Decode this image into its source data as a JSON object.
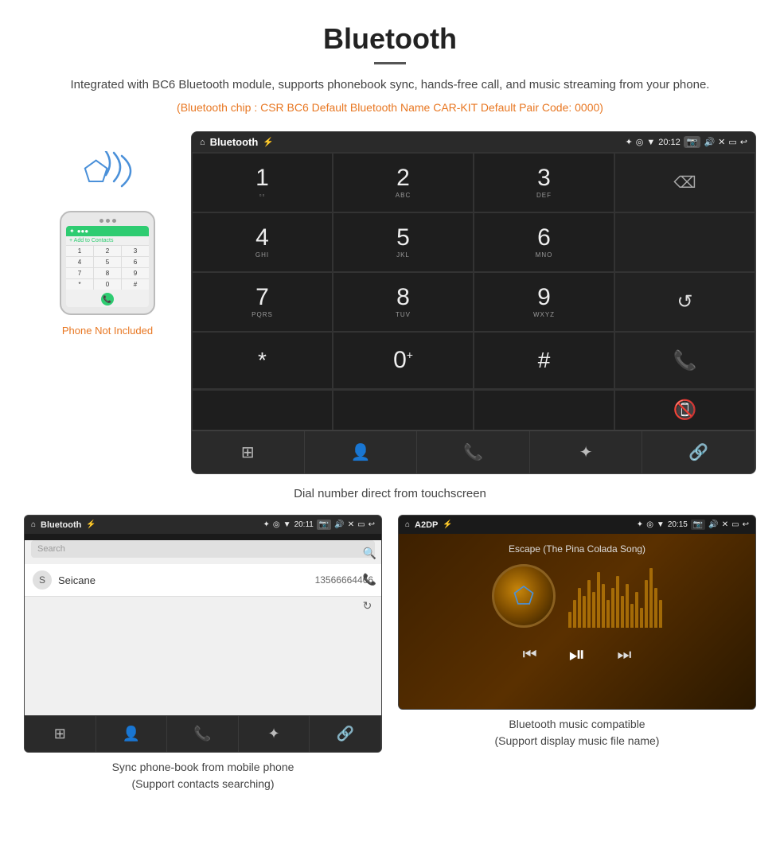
{
  "header": {
    "title": "Bluetooth",
    "description": "Integrated with BC6 Bluetooth module, supports phonebook sync, hands-free call, and music streaming from your phone.",
    "info_line": "(Bluetooth chip : CSR BC6    Default Bluetooth Name CAR-KIT    Default Pair Code: 0000)"
  },
  "phone_label": "Phone Not Included",
  "dialer": {
    "status_bar": {
      "title": "Bluetooth",
      "time": "20:12",
      "usb_icon": "⚡",
      "bt_icon": "✦",
      "location_icon": "◉",
      "wifi_icon": "▼"
    },
    "keys": [
      {
        "num": "1",
        "sub": ""
      },
      {
        "num": "2",
        "sub": "ABC"
      },
      {
        "num": "3",
        "sub": "DEF"
      },
      {
        "num": "",
        "sub": ""
      },
      {
        "num": "4",
        "sub": "GHI"
      },
      {
        "num": "5",
        "sub": "JKL"
      },
      {
        "num": "6",
        "sub": "MNO"
      },
      {
        "num": "",
        "sub": ""
      },
      {
        "num": "7",
        "sub": "PQRS"
      },
      {
        "num": "8",
        "sub": "TUV"
      },
      {
        "num": "9",
        "sub": "WXYZ"
      },
      {
        "num": "reload",
        "sub": ""
      },
      {
        "num": "*",
        "sub": ""
      },
      {
        "num": "0",
        "sub": "+"
      },
      {
        "num": "#",
        "sub": ""
      },
      {
        "num": "call_green",
        "sub": ""
      },
      {
        "num": "end_red",
        "sub": ""
      }
    ],
    "bottom_icons": [
      "grid",
      "person",
      "phone",
      "bluetooth",
      "link"
    ]
  },
  "caption_main": "Dial number direct from touchscreen",
  "phonebook": {
    "status_bar": {
      "title": "Bluetooth",
      "time": "20:11"
    },
    "search_placeholder": "Search",
    "contact": {
      "letter": "S",
      "name": "Seicane",
      "number": "13566664466"
    },
    "bottom_icons": [
      "grid",
      "person",
      "phone",
      "bluetooth",
      "link"
    ]
  },
  "music": {
    "status_bar": {
      "title": "A2DP",
      "time": "20:15"
    },
    "song_title": "Escape (The Pina Colada Song)",
    "bottom_icons": [
      "prev",
      "playpause",
      "next"
    ]
  },
  "caption_phonebook": "Sync phone-book from mobile phone\n(Support contacts searching)",
  "caption_music": "Bluetooth music compatible\n(Support display music file name)"
}
